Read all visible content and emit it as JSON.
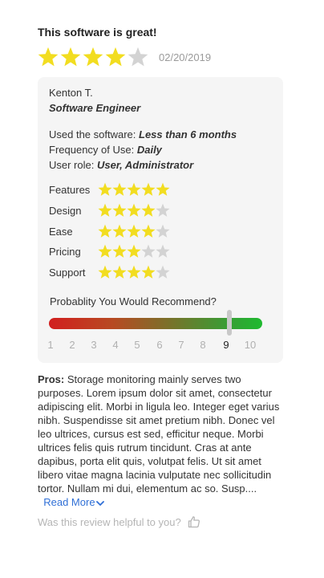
{
  "review": {
    "title": "This software is great!",
    "overall_rating": 4,
    "overall_max": 5,
    "date": "02/20/2019",
    "reviewer": {
      "name": "Kenton T.",
      "job_title": "Software Engineer"
    },
    "details": [
      {
        "label": "Used the software:",
        "value": "Less than 6 months"
      },
      {
        "label": "Frequency of Use:",
        "value": "Daily"
      },
      {
        "label": "User role:",
        "value": "User, Administrator"
      }
    ],
    "ratings": [
      {
        "label": "Features",
        "value": 5
      },
      {
        "label": "Design",
        "value": 4
      },
      {
        "label": "Ease",
        "value": 4
      },
      {
        "label": "Pricing",
        "value": 3
      },
      {
        "label": "Support",
        "value": 4
      }
    ],
    "recommend": {
      "label": "Probablity You Would Recommend?",
      "scale": [
        "1",
        "2",
        "3",
        "4",
        "5",
        "6",
        "7",
        "8",
        "9",
        "10"
      ],
      "selected": 9
    },
    "pros": {
      "label": "Pros:",
      "text": "Storage monitoring mainly serves two purposes. Lorem ipsum dolor sit amet, consectetur adipiscing elit. Morbi in ligula leo. Integer eget varius nibh. Suspendisse sit amet pretium nibh. Donec vel leo ultrices, cursus est sed, efficitur neque. Morbi ultrices felis quis rutrum tincidunt. Cras at ante dapibus, porta elit quis, volutpat felis. Ut sit amet libero vitae magna lacinia vulputate nec sollicitudin tortor. Nullam mi dui, elementum ac so. Susp....",
      "read_more": "Read More"
    },
    "helpful_prompt": "Was this review helpful to you?"
  },
  "colors": {
    "star_filled": "#f2dd20",
    "star_empty": "#d3d3d3",
    "link": "#2f6fd6"
  },
  "icons": {
    "star": "star-icon",
    "chevron": "chevron-down-icon",
    "thumb": "thumbs-up-icon"
  }
}
